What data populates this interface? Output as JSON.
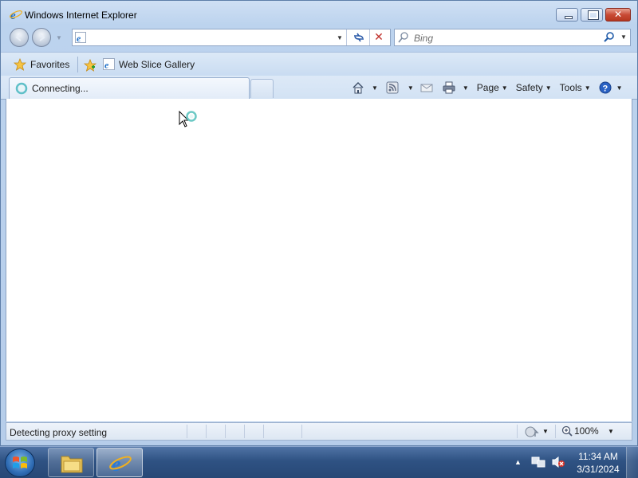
{
  "window": {
    "title": "Windows Internet Explorer"
  },
  "address": {
    "value": "",
    "placeholder": ""
  },
  "search": {
    "placeholder": "Bing"
  },
  "favorites_bar": {
    "favorites_label": "Favorites",
    "web_slice_label": "Web Slice Gallery"
  },
  "tab": {
    "label": "Connecting..."
  },
  "command_bar": {
    "page_label": "Page",
    "safety_label": "Safety",
    "tools_label": "Tools"
  },
  "status": {
    "text": "Detecting proxy setting",
    "zoom": "100%"
  },
  "taskbar": {
    "time": "11:34 AM",
    "date": "3/31/2024"
  },
  "colors": {
    "accent": "#1e6fc8",
    "stop": "#c0302a",
    "taskbar": "#2f5283"
  }
}
